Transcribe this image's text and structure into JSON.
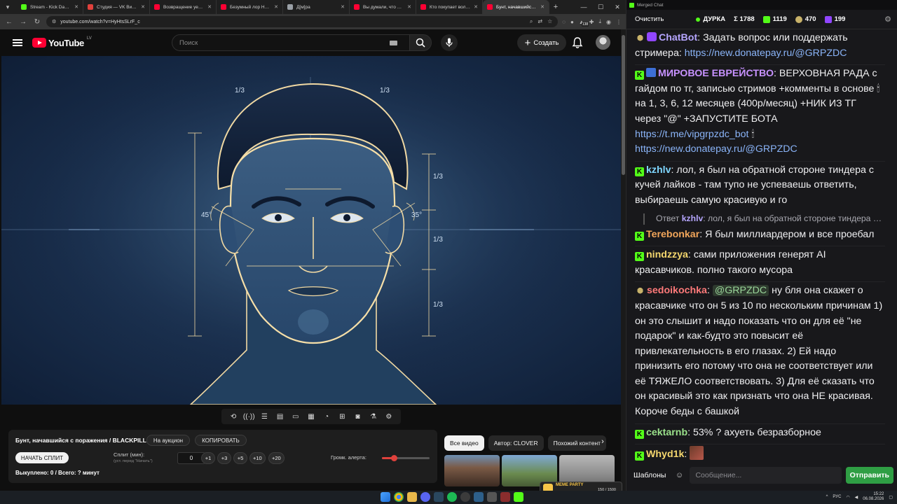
{
  "browser": {
    "tabs": [
      {
        "label": "Stream - Kick Dashboard",
        "color": "#53fc18",
        "active": false
      },
      {
        "label": "Студия — VK Видео | ...",
        "color": "#e0413c",
        "active": false
      },
      {
        "label": "Возвращение уехавших...",
        "color": "#ff0033",
        "active": false
      },
      {
        "label": "Безумный лор Никон...",
        "color": "#ff0033",
        "active": false
      },
      {
        "label": "Д[м]ра",
        "color": "#9aa0a6",
        "active": false
      },
      {
        "label": "Вы думали, что ловит...",
        "color": "#ff0033",
        "active": false
      },
      {
        "label": "Кто покупает волосы...",
        "color": "#ff0033",
        "active": false
      },
      {
        "label": "Бунт, начавшийся...",
        "color": "#ff0033",
        "active": true
      }
    ],
    "url": "youtube.com/watch?v=HyHtsSLrF_c",
    "ext_badge": "138"
  },
  "youtube": {
    "logo_text": "YouTube",
    "logo_region": "LV",
    "search_placeholder": "Поиск",
    "create_label": "Создать"
  },
  "video": {
    "overlay_labels": {
      "third_top_left": "1/3",
      "third_top_right": "1/3",
      "third_r1": "1/3",
      "third_r2": "1/3",
      "third_r3": "1/3",
      "angle_left": "45°",
      "angle_right": "35°"
    }
  },
  "extension": {
    "title": "Бунт, начавшийся с поражения / BLACKPILL",
    "auction_label": "На аукцион",
    "copy_label": "КОПИРОВАТЬ",
    "start_split_label": "НАЧАТЬ СПЛИТ",
    "split_label": "Сплит (мин):",
    "split_sub": "(уст. перед \"Начать\")",
    "split_value": "0",
    "increments": [
      "+1",
      "+3",
      "+5",
      "+10",
      "+20"
    ],
    "volume_label": "Громк. алерта:",
    "volume_fraction": 0.25,
    "status": "Выкуплено: 0 / Всего: ? минут"
  },
  "suggestions": {
    "chips": [
      "Все видео",
      "Автор: CLOVER",
      "Похожий контент"
    ],
    "selected_chip": 0
  },
  "meme_badge": {
    "label": "MEME PARTY",
    "count": "150 / 1500"
  },
  "taskbar": {
    "lang": "РУС",
    "time": "15:22",
    "date": "06.08.2026"
  },
  "chat": {
    "window_title": "Merged Chat",
    "clear_label": "Очистить",
    "channel": "ДУРКА",
    "stats": {
      "total": "Σ 1788",
      "kick": "1119",
      "other": "470",
      "vk": "199"
    },
    "messages": [
      {
        "user": "ChatBot",
        "color": "#b6a6ff",
        "text": "Задать вопрос или поддержать стримера: ",
        "link": "https://new.donatepay.ru/@GRPZDC"
      },
      {
        "user": "МИРОВОЕ ЕВРЕЙСТВО",
        "color": "#c792ff",
        "text": "ВЕРХОВНАЯ РАДА с гайдом по тг, записью стримов +комменты в основе 🕯 на 1, 3, 6, 12 месяцев (400р/месяц) +НИК ИЗ ТГ через \"@\" +ЗАПУСТИТЕ БОТА ",
        "link": "https://t.me/vipgrpzdc_bot",
        "link2": "https://new.donatepay.ru/@GRPZDC"
      },
      {
        "user": "kzhlv",
        "color": "#7fd7ff",
        "text": "лол, я был на обратной стороне тиндера с кучей лайков - там тупо не успеваешь ответить, выбираешь самую красивую и го"
      },
      {
        "reply_prefix": "Ответ",
        "reply_user": "kzhlv",
        "reply_text": "лол, я был на обратной стороне тиндера с ..."
      },
      {
        "user": "Terebonkar",
        "color": "#f2a65a",
        "text": "Я был миллиардером и все проебал"
      },
      {
        "user": "nindzzya",
        "color": "#f5d76e",
        "text": "сами приложения генерят AI красавчиков. полно такого мусора"
      },
      {
        "user": "sedoikochka",
        "color": "#ff7a7a",
        "mention": "@GRPZDC",
        "text": "ну бля она скажет о красавчике что он 5 из 10 по нескольким причинам 1) он это слышит и надо показать что он для её \"не подарок\" и как-будто это повысит её привлекательность в его глазах. 2) Ей надо принизить его потому что она не соответствует или её ТЯЖЕЛО соответствовать. 3) Для её сказать что он красивый это как признать что она НЕ красивая. Короче беды с башкой"
      },
      {
        "user": "cektarnb",
        "color": "#9be28b",
        "text": "53% ? ахуеть безразборное"
      },
      {
        "user": "Whyd1k",
        "color": "#f5d76e",
        "text": ""
      }
    ],
    "templates_label": "Шаблоны",
    "input_placeholder": "Сообщение...",
    "send_label": "Отправить"
  }
}
